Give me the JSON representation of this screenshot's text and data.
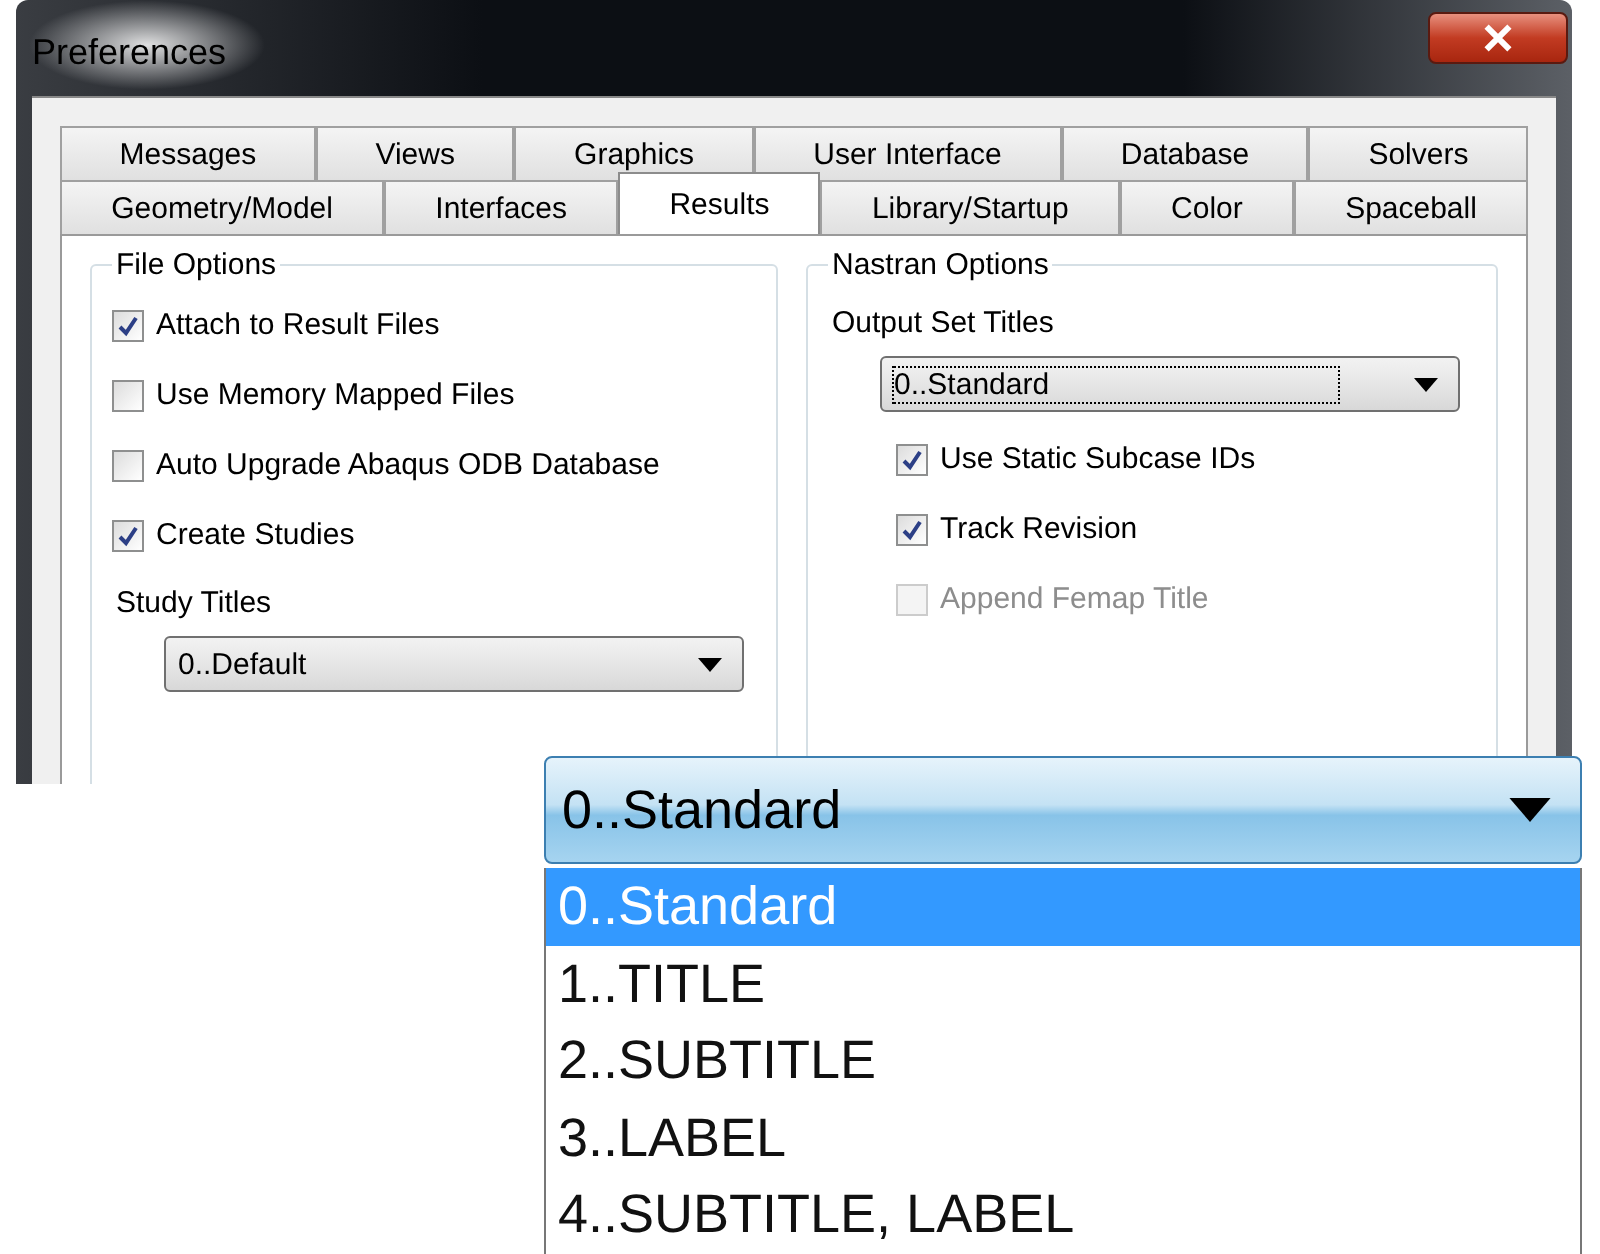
{
  "window": {
    "title": "Preferences"
  },
  "tab_rows": [
    [
      {
        "label": "Messages",
        "selected": false
      },
      {
        "label": "Views",
        "selected": false
      },
      {
        "label": "Graphics",
        "selected": false
      },
      {
        "label": "User Interface",
        "selected": false
      },
      {
        "label": "Database",
        "selected": false
      },
      {
        "label": "Solvers",
        "selected": false
      }
    ],
    [
      {
        "label": "Geometry/Model",
        "selected": false
      },
      {
        "label": "Interfaces",
        "selected": false
      },
      {
        "label": "Results",
        "selected": true
      },
      {
        "label": "Library/Startup",
        "selected": false
      },
      {
        "label": "Color",
        "selected": false
      },
      {
        "label": "Spaceball",
        "selected": false
      }
    ]
  ],
  "file_options": {
    "title": "File Options",
    "checkboxes": [
      {
        "label": "Attach to Result Files",
        "checked": true,
        "disabled": false
      },
      {
        "label": "Use Memory Mapped Files",
        "checked": false,
        "disabled": false
      },
      {
        "label": "Auto Upgrade Abaqus ODB Database",
        "checked": false,
        "disabled": false
      },
      {
        "label": "Create Studies",
        "checked": true,
        "disabled": false
      }
    ],
    "study_titles": {
      "label": "Study Titles",
      "value": "0..Default"
    }
  },
  "nastran_options": {
    "title": "Nastran Options",
    "output_set_titles": {
      "label": "Output Set Titles",
      "value": "0..Standard"
    },
    "checkboxes": [
      {
        "label": "Use Static Subcase IDs",
        "checked": true,
        "disabled": false
      },
      {
        "label": "Track Revision",
        "checked": true,
        "disabled": false
      },
      {
        "label": "Append Femap Title",
        "checked": false,
        "disabled": true
      }
    ]
  },
  "zoomed_dropdown": {
    "value": "0..Standard",
    "options": [
      {
        "label": "0..Standard",
        "selected": true
      },
      {
        "label": "1..TITLE",
        "selected": false
      },
      {
        "label": "2..SUBTITLE",
        "selected": false
      },
      {
        "label": "3..LABEL",
        "selected": false
      },
      {
        "label": "4..SUBTITLE, LABEL",
        "selected": false
      }
    ]
  }
}
